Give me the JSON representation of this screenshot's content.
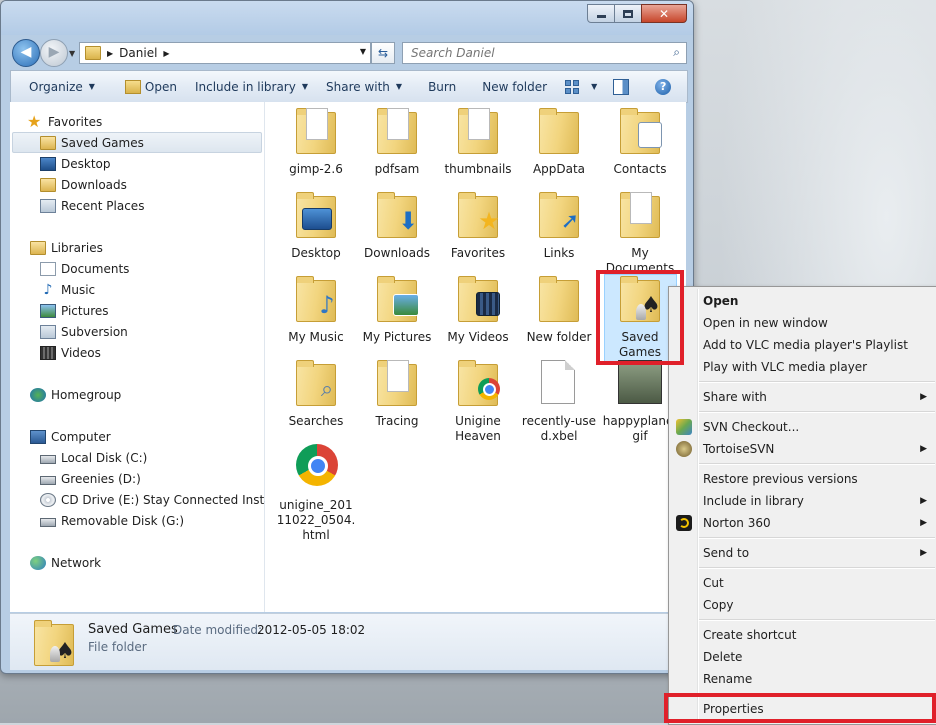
{
  "window": {
    "nav": {
      "address_segments": [
        "Daniel"
      ],
      "search_placeholder": "Search Daniel"
    },
    "toolbar": {
      "organize": "Organize",
      "open": "Open",
      "include_in_library": "Include in library",
      "share_with": "Share with",
      "burn": "Burn",
      "new_folder": "New folder",
      "help": "?"
    },
    "navpane": {
      "favorites": "Favorites",
      "saved_games": "Saved Games",
      "desktop": "Desktop",
      "downloads": "Downloads",
      "recent_places": "Recent Places",
      "libraries": "Libraries",
      "documents": "Documents",
      "music": "Music",
      "pictures": "Pictures",
      "subversion": "Subversion",
      "videos": "Videos",
      "homegroup": "Homegroup",
      "computer": "Computer",
      "local_disk": "Local Disk (C:)",
      "greenies": "Greenies (D:)",
      "cd_drive": "CD Drive (E:) Stay Connected Installer",
      "removable": "Removable Disk (G:)",
      "network": "Network"
    },
    "items": [
      {
        "label": "gimp-2.6",
        "icon": "folder-docs-icon"
      },
      {
        "label": "pdfsam",
        "icon": "folder-doc-icon"
      },
      {
        "label": "thumbnails",
        "icon": "folder-docs-icon"
      },
      {
        "label": "AppData",
        "icon": "folder-icon"
      },
      {
        "label": "Contacts",
        "icon": "contacts-folder-icon"
      },
      {
        "label": "Desktop",
        "icon": "desktop-folder-icon"
      },
      {
        "label": "Downloads",
        "icon": "downloads-folder-icon"
      },
      {
        "label": "Favorites",
        "icon": "favorites-folder-icon"
      },
      {
        "label": "Links",
        "icon": "links-folder-icon"
      },
      {
        "label": "My Documents",
        "icon": "documents-folder-icon"
      },
      {
        "label": "My Music",
        "icon": "music-folder-icon"
      },
      {
        "label": "My Pictures",
        "icon": "pictures-folder-icon"
      },
      {
        "label": "My Videos",
        "icon": "videos-folder-icon"
      },
      {
        "label": "New folder",
        "icon": "folder-icon"
      },
      {
        "label": "Saved Games",
        "icon": "saved-games-folder-icon"
      },
      {
        "label": "Searches",
        "icon": "searches-folder-icon"
      },
      {
        "label": "Tracing",
        "icon": "folder-docs-icon"
      },
      {
        "label": "Unigine Heaven",
        "icon": "chrome-folder-icon"
      },
      {
        "label": "recently-used.xbel",
        "icon": "file-icon"
      },
      {
        "label": "happyplane.gif",
        "icon": "image-thumbnail-icon"
      },
      {
        "label": "unigine_20111022_0504.html",
        "icon": "chrome-icon"
      }
    ],
    "details": {
      "name": "Saved Games",
      "date_label": "Date modified:",
      "date_value": "2012-05-05 18:02",
      "type": "File folder"
    }
  },
  "context_menu": {
    "open": "Open",
    "open_new_window": "Open in new window",
    "vlc_playlist": "Add to VLC media player's Playlist",
    "vlc_play": "Play with VLC media player",
    "share_with": "Share with",
    "svn_checkout": "SVN Checkout...",
    "tortoisesvn": "TortoiseSVN",
    "restore": "Restore previous versions",
    "include_library": "Include in library",
    "norton": "Norton 360",
    "send_to": "Send to",
    "cut": "Cut",
    "copy": "Copy",
    "create_shortcut": "Create shortcut",
    "delete": "Delete",
    "rename": "Rename",
    "properties": "Properties"
  },
  "colors": {
    "highlight": "#e0202a",
    "selection": "#cce8ff"
  }
}
